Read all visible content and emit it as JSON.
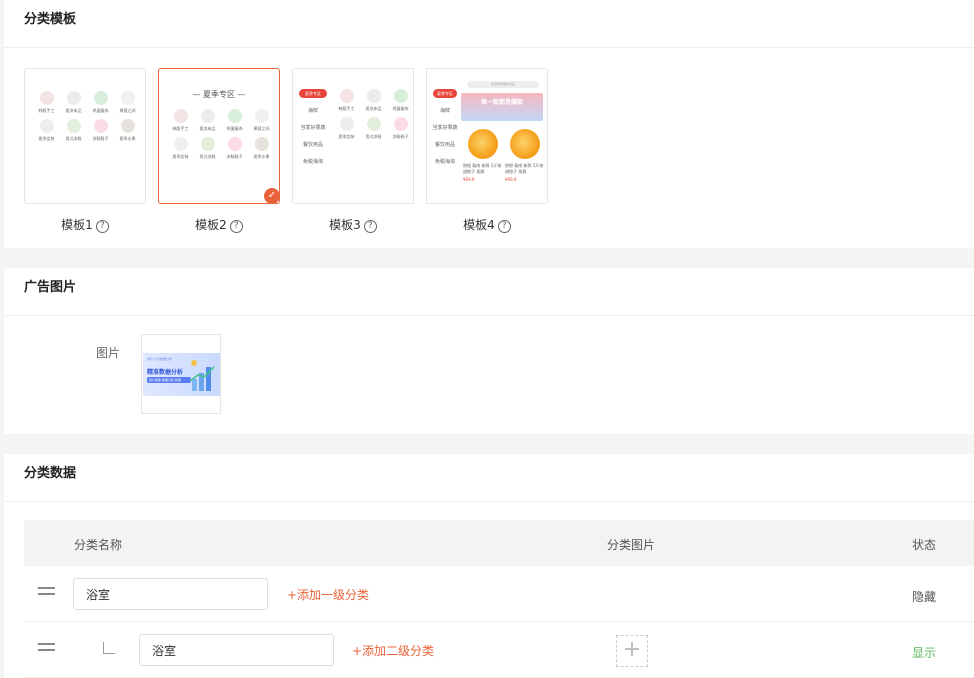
{
  "templates_section": {
    "title": "分类模板",
    "help_glyph": "?",
    "templates": [
      {
        "label": "模板1"
      },
      {
        "label": "模板2"
      },
      {
        "label": "模板3"
      },
      {
        "label": "模板4"
      }
    ],
    "selected_index": 1,
    "preview": {
      "zone_title": "— 夏季专区 —",
      "grid_items": [
        "韩版手工",
        "夏凉床品",
        "鸡蛋瘦肉",
        "果蔬之间",
        "夏季女装",
        "男式凉鞋",
        "凉鞋鞋子",
        "夏季水果"
      ],
      "side_items": [
        "夏季专区",
        "海鲜",
        "当季好果蔬",
        "餐饮用品",
        "免税海淘"
      ],
      "t4_search": "搜索你想要的商品",
      "t4_banner": "每一款都是爆款",
      "t4_item_desc": "脐橙 赣南 新鲜 5斤装 甜橙子 现摘",
      "t4_price": "¥69.9"
    }
  },
  "ad_section": {
    "title": "广告图片",
    "field_label": "图片",
    "banner": {
      "small": "用户 行为数据分析",
      "title": "精准数据分析",
      "pill": "用户画像 数据分析 营销"
    }
  },
  "data_section": {
    "title": "分类数据",
    "columns": {
      "name": "分类名称",
      "image": "分类图片",
      "status": "状态"
    },
    "rows": [
      {
        "level": 1,
        "name": "浴室",
        "add_link": "+添加一级分类",
        "status": "隐藏"
      },
      {
        "level": 2,
        "name": "浴室",
        "add_link": "+添加二级分类",
        "status": "显示",
        "upload_glyph": "+"
      }
    ]
  },
  "colors": {
    "accent": "#e9633a",
    "status_shown": "#5cb85c"
  }
}
